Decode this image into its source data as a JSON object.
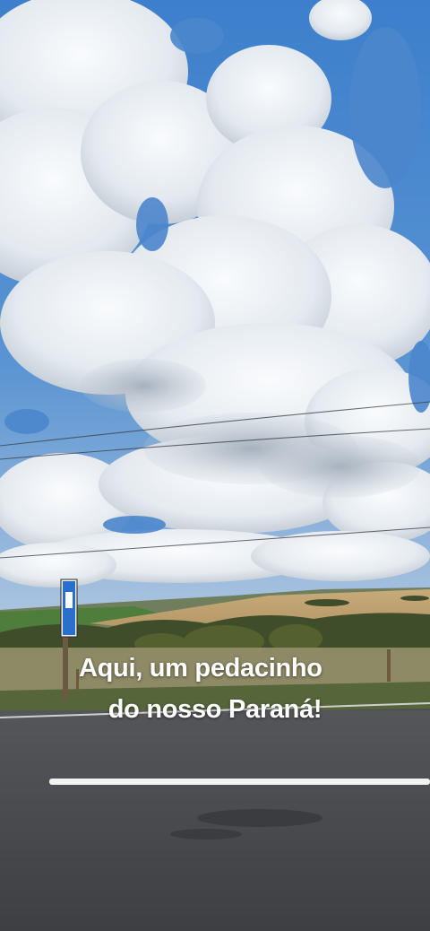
{
  "caption": {
    "line1": "Aqui, um pedacinho",
    "line2": "do nosso Paraná!"
  },
  "scene": {
    "sky_color": "#4a88d0",
    "cloud_color": "#eef1f4",
    "field_color": "#c9a774",
    "grass_color": "#5d6b3a",
    "road_color": "#48494d",
    "lane_marking_color": "#f2f2f2",
    "sign_color": "#2a6fc9"
  }
}
